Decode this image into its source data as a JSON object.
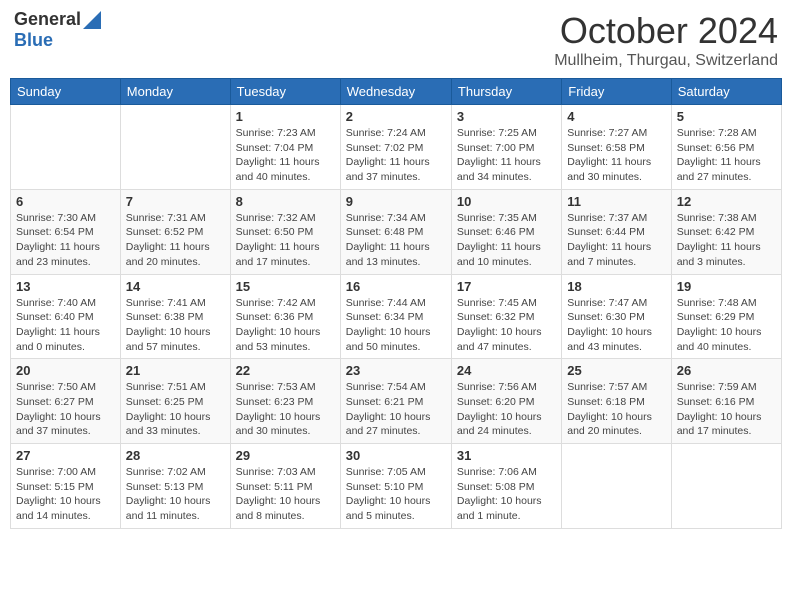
{
  "header": {
    "logo_general": "General",
    "logo_blue": "Blue",
    "month_title": "October 2024",
    "location": "Mullheim, Thurgau, Switzerland"
  },
  "days_of_week": [
    "Sunday",
    "Monday",
    "Tuesday",
    "Wednesday",
    "Thursday",
    "Friday",
    "Saturday"
  ],
  "weeks": [
    [
      {
        "day": "",
        "info": ""
      },
      {
        "day": "",
        "info": ""
      },
      {
        "day": "1",
        "info": "Sunrise: 7:23 AM\nSunset: 7:04 PM\nDaylight: 11 hours and 40 minutes."
      },
      {
        "day": "2",
        "info": "Sunrise: 7:24 AM\nSunset: 7:02 PM\nDaylight: 11 hours and 37 minutes."
      },
      {
        "day": "3",
        "info": "Sunrise: 7:25 AM\nSunset: 7:00 PM\nDaylight: 11 hours and 34 minutes."
      },
      {
        "day": "4",
        "info": "Sunrise: 7:27 AM\nSunset: 6:58 PM\nDaylight: 11 hours and 30 minutes."
      },
      {
        "day": "5",
        "info": "Sunrise: 7:28 AM\nSunset: 6:56 PM\nDaylight: 11 hours and 27 minutes."
      }
    ],
    [
      {
        "day": "6",
        "info": "Sunrise: 7:30 AM\nSunset: 6:54 PM\nDaylight: 11 hours and 23 minutes."
      },
      {
        "day": "7",
        "info": "Sunrise: 7:31 AM\nSunset: 6:52 PM\nDaylight: 11 hours and 20 minutes."
      },
      {
        "day": "8",
        "info": "Sunrise: 7:32 AM\nSunset: 6:50 PM\nDaylight: 11 hours and 17 minutes."
      },
      {
        "day": "9",
        "info": "Sunrise: 7:34 AM\nSunset: 6:48 PM\nDaylight: 11 hours and 13 minutes."
      },
      {
        "day": "10",
        "info": "Sunrise: 7:35 AM\nSunset: 6:46 PM\nDaylight: 11 hours and 10 minutes."
      },
      {
        "day": "11",
        "info": "Sunrise: 7:37 AM\nSunset: 6:44 PM\nDaylight: 11 hours and 7 minutes."
      },
      {
        "day": "12",
        "info": "Sunrise: 7:38 AM\nSunset: 6:42 PM\nDaylight: 11 hours and 3 minutes."
      }
    ],
    [
      {
        "day": "13",
        "info": "Sunrise: 7:40 AM\nSunset: 6:40 PM\nDaylight: 11 hours and 0 minutes."
      },
      {
        "day": "14",
        "info": "Sunrise: 7:41 AM\nSunset: 6:38 PM\nDaylight: 10 hours and 57 minutes."
      },
      {
        "day": "15",
        "info": "Sunrise: 7:42 AM\nSunset: 6:36 PM\nDaylight: 10 hours and 53 minutes."
      },
      {
        "day": "16",
        "info": "Sunrise: 7:44 AM\nSunset: 6:34 PM\nDaylight: 10 hours and 50 minutes."
      },
      {
        "day": "17",
        "info": "Sunrise: 7:45 AM\nSunset: 6:32 PM\nDaylight: 10 hours and 47 minutes."
      },
      {
        "day": "18",
        "info": "Sunrise: 7:47 AM\nSunset: 6:30 PM\nDaylight: 10 hours and 43 minutes."
      },
      {
        "day": "19",
        "info": "Sunrise: 7:48 AM\nSunset: 6:29 PM\nDaylight: 10 hours and 40 minutes."
      }
    ],
    [
      {
        "day": "20",
        "info": "Sunrise: 7:50 AM\nSunset: 6:27 PM\nDaylight: 10 hours and 37 minutes."
      },
      {
        "day": "21",
        "info": "Sunrise: 7:51 AM\nSunset: 6:25 PM\nDaylight: 10 hours and 33 minutes."
      },
      {
        "day": "22",
        "info": "Sunrise: 7:53 AM\nSunset: 6:23 PM\nDaylight: 10 hours and 30 minutes."
      },
      {
        "day": "23",
        "info": "Sunrise: 7:54 AM\nSunset: 6:21 PM\nDaylight: 10 hours and 27 minutes."
      },
      {
        "day": "24",
        "info": "Sunrise: 7:56 AM\nSunset: 6:20 PM\nDaylight: 10 hours and 24 minutes."
      },
      {
        "day": "25",
        "info": "Sunrise: 7:57 AM\nSunset: 6:18 PM\nDaylight: 10 hours and 20 minutes."
      },
      {
        "day": "26",
        "info": "Sunrise: 7:59 AM\nSunset: 6:16 PM\nDaylight: 10 hours and 17 minutes."
      }
    ],
    [
      {
        "day": "27",
        "info": "Sunrise: 7:00 AM\nSunset: 5:15 PM\nDaylight: 10 hours and 14 minutes."
      },
      {
        "day": "28",
        "info": "Sunrise: 7:02 AM\nSunset: 5:13 PM\nDaylight: 10 hours and 11 minutes."
      },
      {
        "day": "29",
        "info": "Sunrise: 7:03 AM\nSunset: 5:11 PM\nDaylight: 10 hours and 8 minutes."
      },
      {
        "day": "30",
        "info": "Sunrise: 7:05 AM\nSunset: 5:10 PM\nDaylight: 10 hours and 5 minutes."
      },
      {
        "day": "31",
        "info": "Sunrise: 7:06 AM\nSunset: 5:08 PM\nDaylight: 10 hours and 1 minute."
      },
      {
        "day": "",
        "info": ""
      },
      {
        "day": "",
        "info": ""
      }
    ]
  ]
}
